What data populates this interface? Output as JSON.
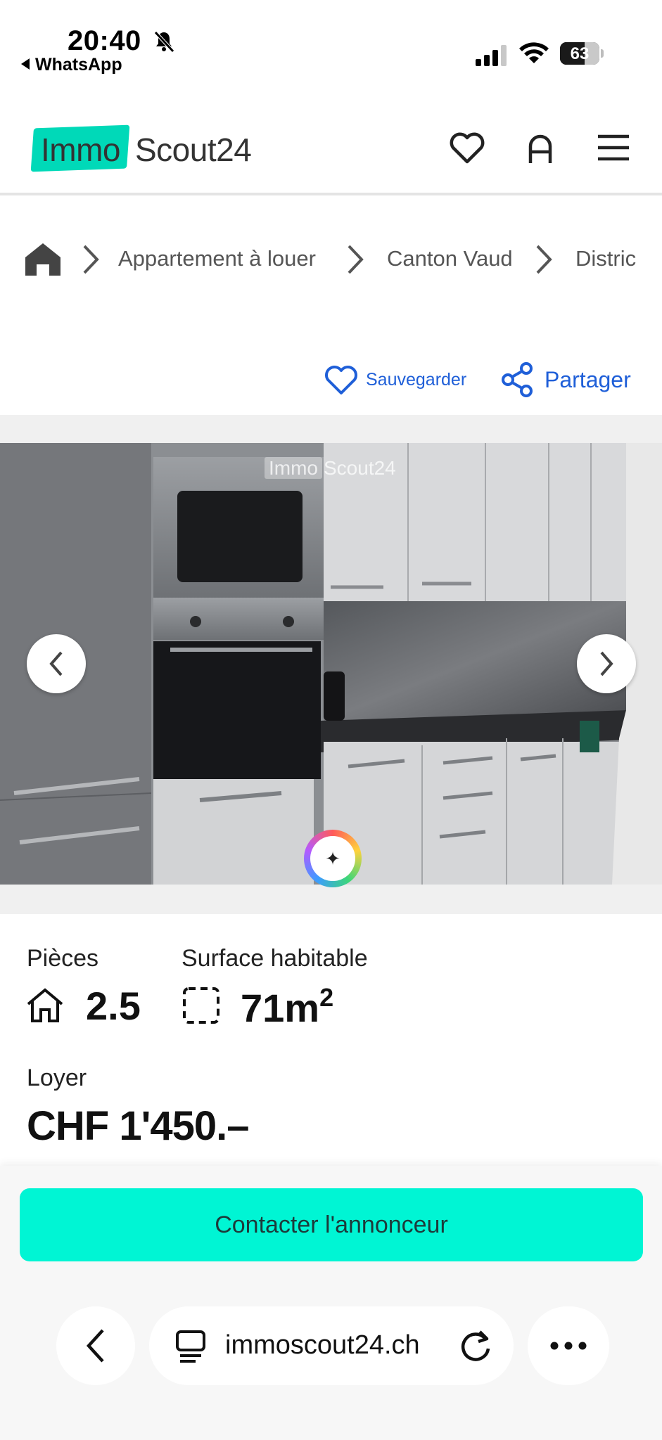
{
  "status_bar": {
    "time": "20:40",
    "back_app": "WhatsApp",
    "battery": "63",
    "battery_level": 0.63
  },
  "header": {
    "logo_immo": "Immo",
    "logo_scout": "Scout24",
    "icons": [
      "heart-icon",
      "user-icon",
      "menu-icon"
    ]
  },
  "breadcrumb": {
    "items": [
      "Appartement à louer",
      "Canton Vaud",
      "Distric"
    ]
  },
  "actions": {
    "save": "Sauvegarder",
    "share": "Partager"
  },
  "gallery": {
    "watermark_immo": "Immo",
    "watermark_scout": "Scout24"
  },
  "details": {
    "rooms_label": "Pièces",
    "rooms_value": "2.5",
    "area_label": "Surface habitable",
    "area_value": "71m",
    "area_unit_sup": "2",
    "rent_label": "Loyer",
    "rent_value": "CHF 1'450.–"
  },
  "bottom": {
    "contact": "Contacter l'annonceur",
    "url": "immoscout24.ch"
  },
  "colors": {
    "brand_teal": "#00d9b8",
    "cta_teal": "#00f5d4",
    "link_blue": "#1f5fd8"
  }
}
